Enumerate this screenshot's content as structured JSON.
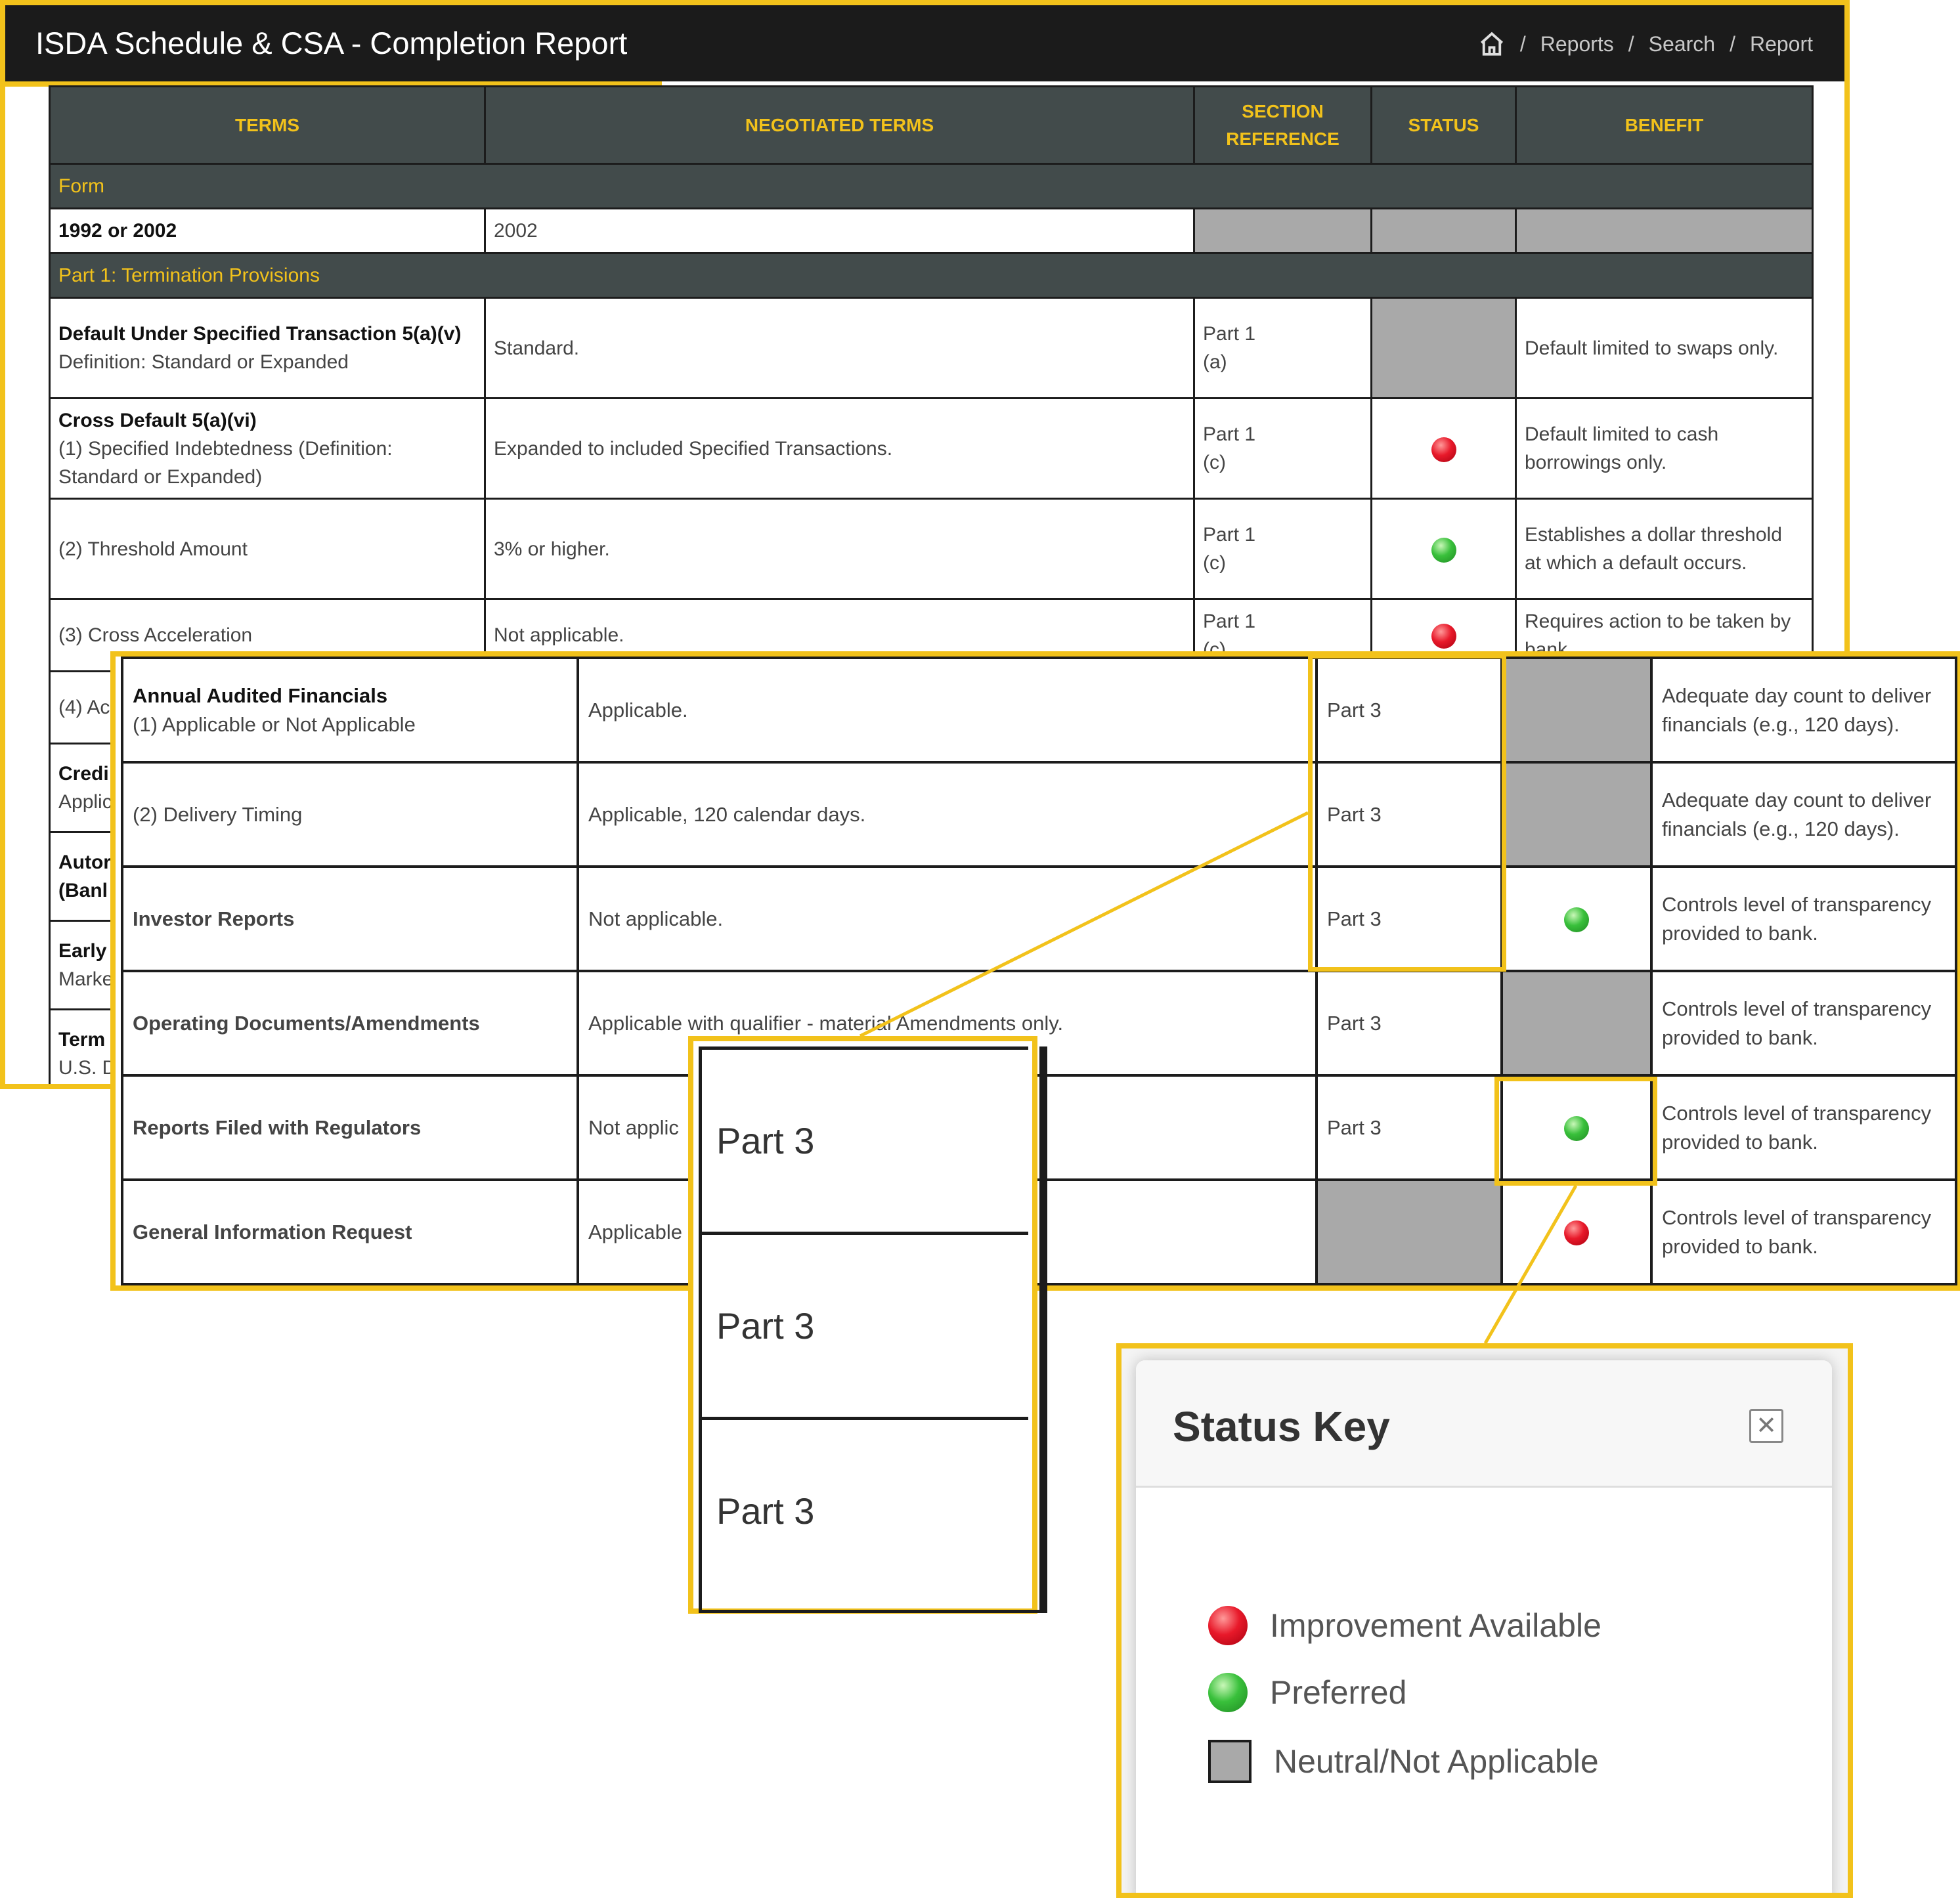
{
  "header": {
    "title": "ISDA Schedule & CSA - Completion Report",
    "breadcrumbs": [
      {
        "label": "Reports"
      },
      {
        "label": "Search"
      },
      {
        "label": "Report"
      }
    ],
    "separator": "/"
  },
  "table": {
    "columns": [
      "TERMS",
      "NEGOTIATED TERMS",
      "SECTION\nREFERENCE",
      "STATUS",
      "BENEFIT"
    ],
    "section_form": "Form",
    "form_row": {
      "term": "1992 or 2002",
      "negotiated": "2002"
    },
    "section_part1": "Part 1: Termination Provisions",
    "rows": [
      {
        "term": "Default Under Specified Transaction 5(a)(v)",
        "term_sub": "Definition: Standard or Expanded",
        "negotiated": "Standard.",
        "section": "Part 1\n(a)",
        "status": "neutral",
        "benefit": "Default limited to swaps only."
      },
      {
        "term": "Cross Default 5(a)(vi)",
        "term_sub": "(1) Specified Indebtedness (Definition: Standard or Expanded)",
        "negotiated": "Expanded to included Specified Transactions.",
        "section": "Part 1\n(c)",
        "status": "red",
        "benefit": "Default limited to cash borrowings only."
      },
      {
        "term": "",
        "term_sub": "(2) Threshold Amount",
        "negotiated": "3% or higher.",
        "section": "Part 1\n(c)",
        "status": "green",
        "benefit": "Establishes a dollar threshold at which a default occurs."
      },
      {
        "term": "",
        "term_sub": "(3) Cross Acceleration",
        "negotiated": "Not applicable.",
        "section": "Part 1\n(c)",
        "status": "red",
        "benefit": "Requires action to be taken by bank."
      }
    ],
    "partial_terms": [
      {
        "a": "(4) Ac",
        "b": ""
      },
      {
        "a": "Credi",
        "b": "Applic"
      },
      {
        "a": "Autor",
        "b": "(Banl"
      },
      {
        "a": "Early",
        "b": "Marke"
      },
      {
        "a": "Term",
        "b": "U.S. D"
      }
    ]
  },
  "zoom_table": {
    "rows": [
      {
        "term": "Annual Audited Financials",
        "term_sub": "(1) Applicable or Not Applicable",
        "negotiated": "Applicable.",
        "section": "Part 3",
        "status": "neutral",
        "benefit": "Adequate day count to deliver financials (e.g., 120 days)."
      },
      {
        "term": "",
        "term_sub": "(2) Delivery Timing",
        "negotiated": "Applicable, 120 calendar days.",
        "section": "Part 3",
        "status": "neutral",
        "benefit": "Adequate day count to deliver financials (e.g., 120 days)."
      },
      {
        "term": "Investor Reports",
        "term_sub": "",
        "negotiated": "Not applicable.",
        "section": "Part 3",
        "status": "green",
        "benefit": "Controls level of transparency provided to bank."
      },
      {
        "term": "Operating Documents/Amendments",
        "term_sub": "",
        "negotiated": "Applicable with qualifier - material Amendments only.",
        "section": "Part 3",
        "status": "neutral",
        "benefit": "Controls level of transparency provided to bank."
      },
      {
        "term": "Reports Filed with Regulators",
        "term_sub": "",
        "negotiated": "Not applic",
        "section": "Part 3",
        "status": "green",
        "benefit": "Controls level of transparency provided to bank."
      },
      {
        "term": "General Information Request",
        "term_sub": "",
        "negotiated": "Applicable",
        "section": "",
        "status": "red",
        "benefit": "Controls level of transparency provided to bank."
      }
    ]
  },
  "zoom_cells": [
    "Part 3",
    "Part 3",
    "Part 3"
  ],
  "status_key": {
    "title": "Status Key",
    "close_icon": "close-icon",
    "items": [
      {
        "label": "Improvement Available",
        "kind": "red"
      },
      {
        "label": "Preferred",
        "kind": "green"
      },
      {
        "label": "Neutral/Not Applicable",
        "kind": "neutral"
      }
    ]
  },
  "colors": {
    "accent": "#f2c21b",
    "header_bg": "#1b1b1b",
    "table_header": "#424b4b",
    "neutral": "#a9a9a9"
  }
}
